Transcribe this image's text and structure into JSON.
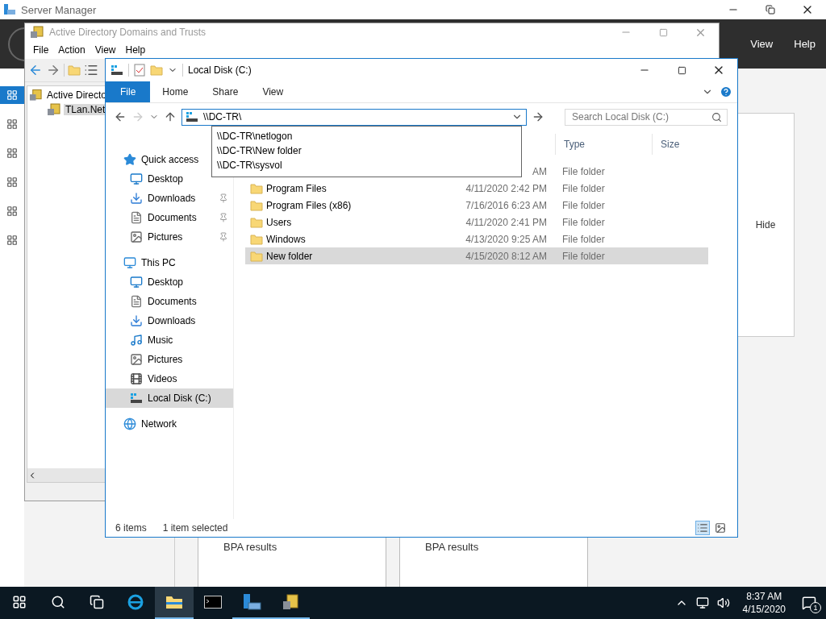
{
  "server_manager": {
    "title": "Server Manager",
    "header_menu": [
      "View",
      "Help"
    ],
    "hide_label": "Hide",
    "tiles": [
      {
        "label": "BPA results"
      },
      {
        "label": "BPA results"
      }
    ]
  },
  "ad_window": {
    "title": "Active Directory Domains and Trusts",
    "menu": [
      "File",
      "Action",
      "View",
      "Help"
    ],
    "tree": [
      {
        "label": "Active Directo",
        "selected": false,
        "children": [
          {
            "label": "TLan.Net",
            "selected": true
          }
        ]
      }
    ]
  },
  "explorer": {
    "title": "Local Disk (C:)",
    "ribbon_tabs": [
      {
        "label": "File",
        "selected": true
      },
      {
        "label": "Home",
        "selected": false
      },
      {
        "label": "Share",
        "selected": false
      },
      {
        "label": "View",
        "selected": false
      }
    ],
    "address": "\\\\DC-TR\\",
    "search_placeholder": "Search Local Disk (C:)",
    "suggestions": [
      "\\\\DC-TR\\netlogon",
      "\\\\DC-TR\\New folder",
      "\\\\DC-TR\\sysvol"
    ],
    "nav": [
      {
        "label": "Quick access",
        "kind": "star",
        "selected": false,
        "children": [
          {
            "label": "Desktop",
            "kind": "desktop",
            "selected": false
          },
          {
            "label": "Downloads",
            "kind": "download",
            "pinned": true,
            "selected": false
          },
          {
            "label": "Documents",
            "kind": "document",
            "pinned": true,
            "selected": false
          },
          {
            "label": "Pictures",
            "kind": "picture",
            "pinned": true,
            "selected": false
          }
        ]
      },
      {
        "label": "This PC",
        "kind": "pc",
        "selected": false,
        "children": [
          {
            "label": "Desktop",
            "kind": "desktop",
            "selected": false
          },
          {
            "label": "Documents",
            "kind": "document",
            "selected": false
          },
          {
            "label": "Downloads",
            "kind": "download",
            "selected": false
          },
          {
            "label": "Music",
            "kind": "music",
            "selected": false
          },
          {
            "label": "Pictures",
            "kind": "picture",
            "selected": false
          },
          {
            "label": "Videos",
            "kind": "video",
            "selected": false
          },
          {
            "label": "Local Disk (C:)",
            "kind": "drive",
            "selected": true
          }
        ]
      },
      {
        "label": "Network",
        "kind": "network",
        "selected": false
      }
    ],
    "columns": [
      "Type",
      "Size"
    ],
    "rows": [
      {
        "date": "AM",
        "type": "File folder",
        "selected": false
      },
      {
        "name": "Program Files",
        "date": "4/11/2020 2:42 PM",
        "type": "File folder",
        "selected": false
      },
      {
        "name": "Program Files (x86)",
        "date": "7/16/2016 6:23 AM",
        "type": "File folder",
        "selected": false
      },
      {
        "name": "Users",
        "date": "4/11/2020 2:41 PM",
        "type": "File folder",
        "selected": false
      },
      {
        "name": "Windows",
        "date": "4/13/2020 9:25 AM",
        "type": "File folder",
        "selected": false
      },
      {
        "name": "New folder",
        "date": "4/15/2020 8:12 AM",
        "type": "File folder",
        "selected": true
      }
    ],
    "status": [
      "6 items",
      "1 item selected"
    ]
  },
  "taskbar": {
    "apps": [
      {
        "kind": "start",
        "selected": false,
        "running": false
      },
      {
        "kind": "search",
        "selected": false,
        "running": false
      },
      {
        "kind": "taskview",
        "selected": false,
        "running": false
      },
      {
        "kind": "browser",
        "selected": false,
        "running": false
      },
      {
        "kind": "explorer",
        "selected": true,
        "running": true
      },
      {
        "kind": "terminal",
        "selected": false,
        "running": false
      },
      {
        "kind": "server",
        "selected": false,
        "running": true
      },
      {
        "kind": "domains",
        "selected": false,
        "running": true
      }
    ],
    "time": "8:37 AM",
    "date": "4/15/2020",
    "notification_count": "1"
  }
}
